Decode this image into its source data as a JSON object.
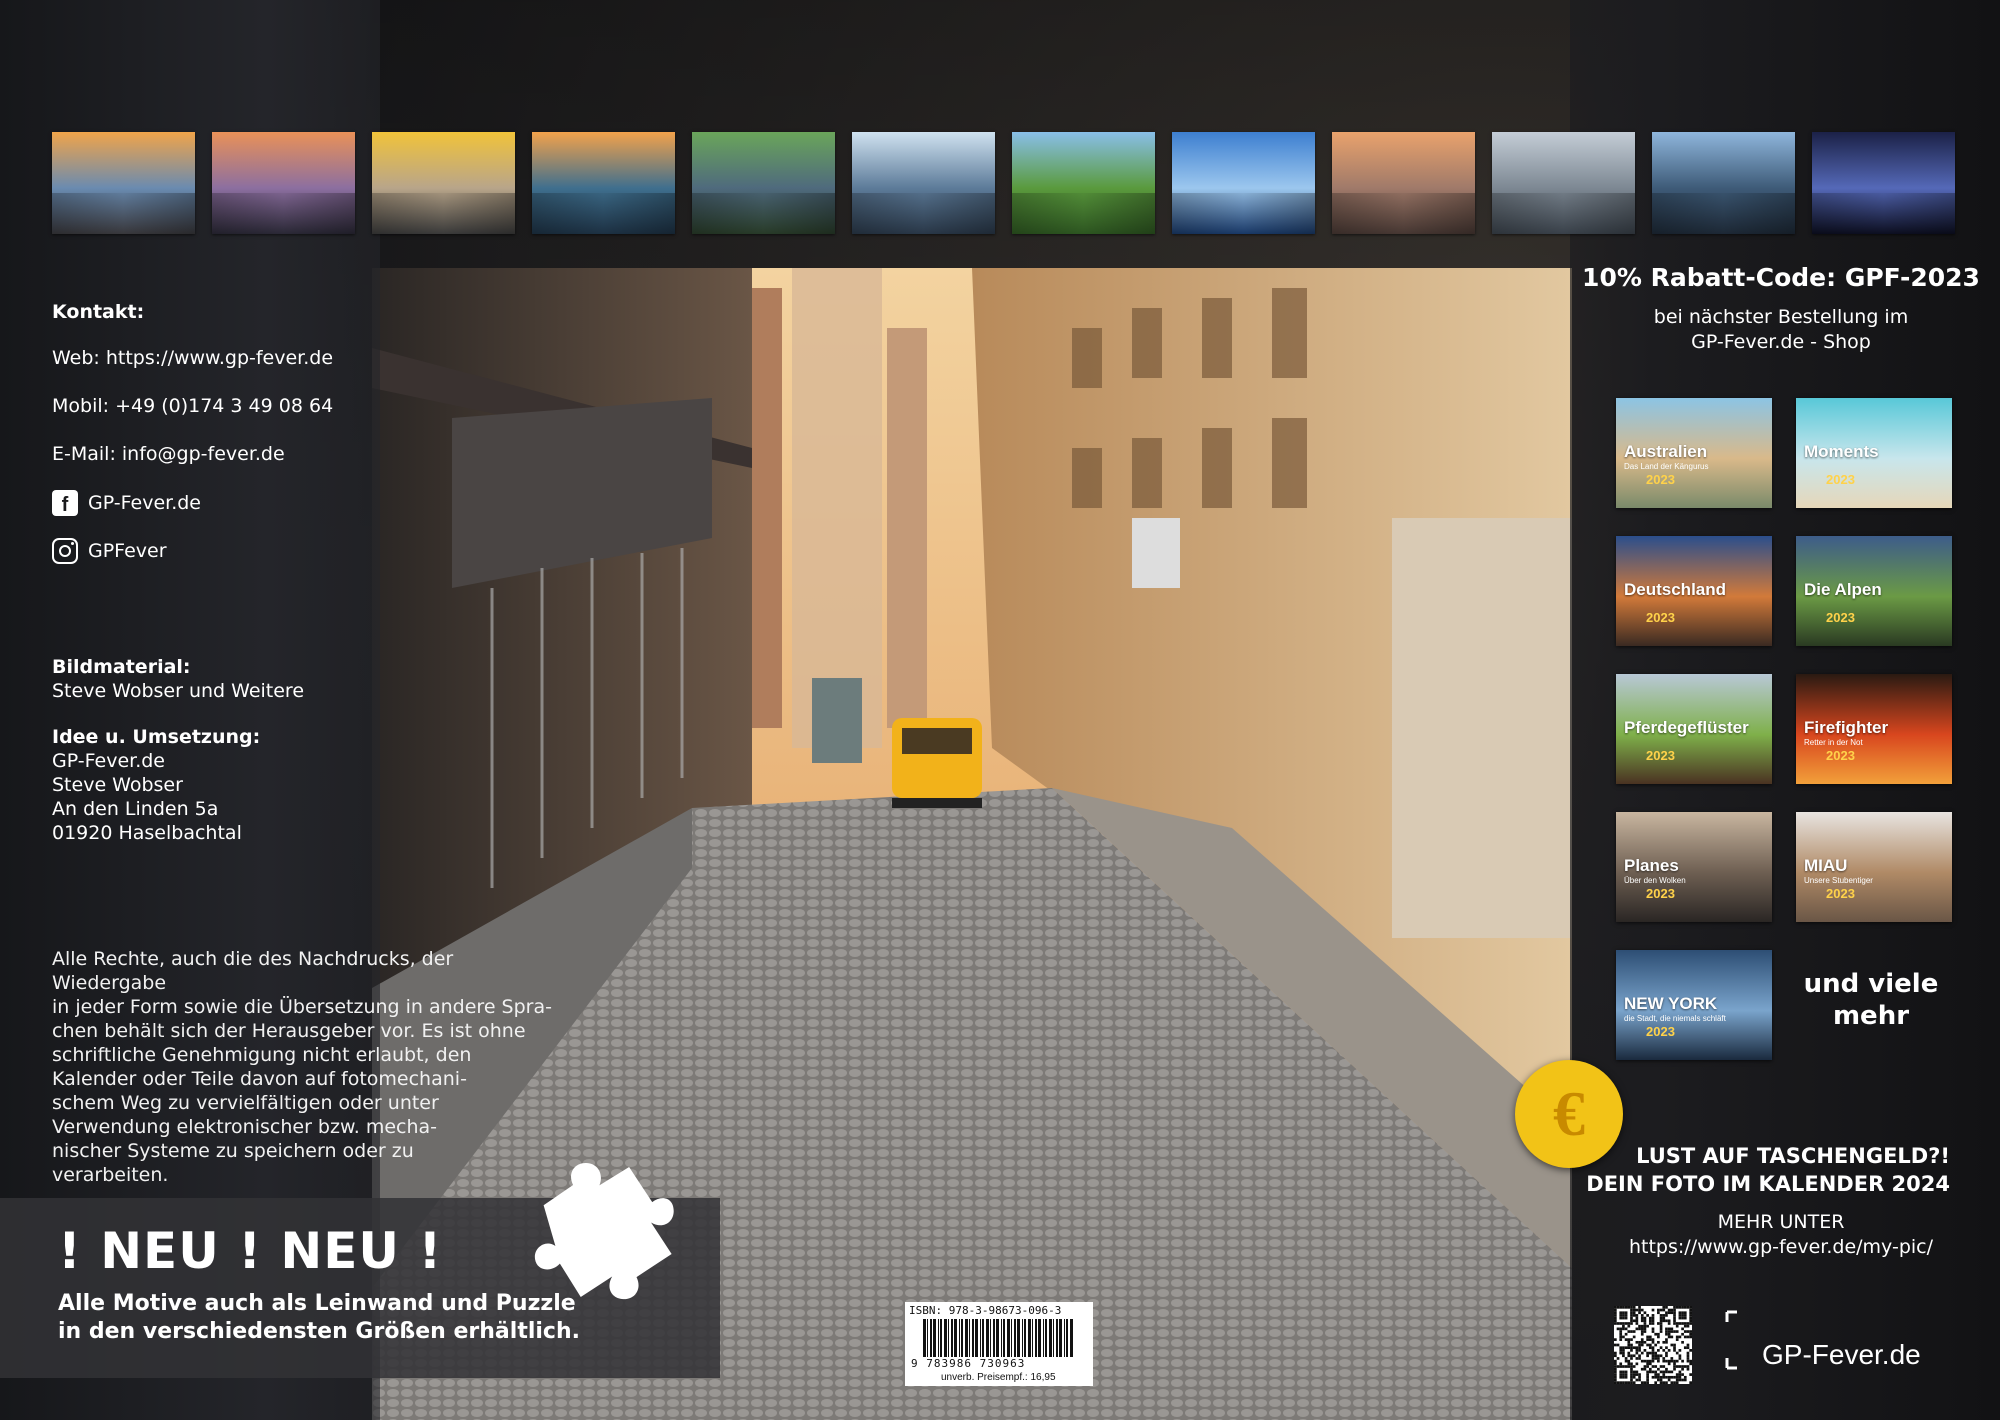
{
  "thumbnails": [
    {
      "name": "brooklyn-bridge-sunset",
      "colors": [
        "#f0a44a",
        "#6a8bb0",
        "#3b3a3e"
      ]
    },
    {
      "name": "statue-of-liberty",
      "colors": [
        "#e99158",
        "#8c6fa0",
        "#2c2a38"
      ]
    },
    {
      "name": "yellow-taxis",
      "colors": [
        "#f1c33a",
        "#b8a58a",
        "#3d3d3d"
      ]
    },
    {
      "name": "manhattan-aerial",
      "colors": [
        "#f2a24b",
        "#3f6f8e",
        "#1e3346"
      ]
    },
    {
      "name": "central-park-aerial",
      "colors": [
        "#6aa55a",
        "#4f6a7d",
        "#2a3e2a"
      ]
    },
    {
      "name": "skyline-waterfront",
      "colors": [
        "#cfe2f0",
        "#5d7b99",
        "#2b3a4b"
      ]
    },
    {
      "name": "park-trees",
      "colors": [
        "#89bfe8",
        "#5a9a3d",
        "#2f5a22"
      ]
    },
    {
      "name": "one-world-trade",
      "colors": [
        "#3d7fd0",
        "#9cc7ee",
        "#1a3b6c"
      ]
    },
    {
      "name": "brooklyn-bridge-walk",
      "colors": [
        "#e9a26c",
        "#a07a6a",
        "#4a3a35"
      ]
    },
    {
      "name": "midtown-skyline",
      "colors": [
        "#c4cdd6",
        "#7d8893",
        "#3c444d"
      ]
    },
    {
      "name": "hudson-yards",
      "colors": [
        "#8fb6dc",
        "#3e5b78",
        "#1e2a38"
      ]
    },
    {
      "name": "tribute-in-light",
      "colors": [
        "#1b2147",
        "#5569b8",
        "#0d0f22"
      ]
    }
  ],
  "contact": {
    "heading": "Kontakt:",
    "web": "Web: https://www.gp-fever.de",
    "mobile": "Mobil: +49 (0)174 3 49 08 64",
    "email": "E-Mail: info@gp-fever.de",
    "facebook": "GP-Fever.de",
    "instagram": "GPFever"
  },
  "credits": {
    "bild_heading": "Bildmaterial:",
    "bild_text": "Steve Wobser und Weitere",
    "idee_heading": "Idee u. Umsetzung:",
    "lines": [
      "GP-Fever.de",
      "Steve Wobser",
      "An den Linden 5a",
      "01920 Haselbachtal"
    ]
  },
  "rights": {
    "lines": [
      "Alle Rechte, auch die des Nachdrucks, der Wiedergabe",
      "in jeder Form sowie die Übersetzung in andere Spra-",
      "chen behält sich der Herausgeber vor. Es ist ohne",
      "schriftliche Genehmigung nicht erlaubt, den",
      "Kalender oder Teile davon auf fotomechani-",
      "schem Weg zu vervielfältigen oder unter",
      "Verwendung elektronischer bzw. mecha-",
      "nischer Systeme zu speichern oder zu",
      "verarbeiten."
    ]
  },
  "neu": {
    "title": "! NEU ! NEU !",
    "line1": "Alle Motive auch als Leinwand und Puzzle",
    "line2": "in den verschiedensten Größen erhältlich."
  },
  "barcode": {
    "isbn": "ISBN: 978-3-98673-096-3",
    "digits": "9 783986 730963",
    "price": "unverb. Preisempf.: 16,95"
  },
  "rabatt": {
    "code": "10% Rabatt-Code: GPF-2023",
    "line1": "bei nächster Bestellung im",
    "line2": "GP-Fever.de - Shop"
  },
  "calendars": [
    {
      "title": "Australien",
      "sub": "Das Land der Kängurus",
      "year": "2023",
      "colors": [
        "#8cc4e4",
        "#d9b98a",
        "#7a8a6a"
      ]
    },
    {
      "title": "Moments",
      "sub": "",
      "year": "2023",
      "colors": [
        "#58c8d8",
        "#c8e6ec",
        "#e6d7b9"
      ]
    },
    {
      "title": "Deutschland",
      "sub": "",
      "year": "2023",
      "colors": [
        "#2b4e8c",
        "#d27a3a",
        "#3a2a22"
      ]
    },
    {
      "title": "Die Alpen",
      "sub": "",
      "year": "2023",
      "colors": [
        "#3d5c8a",
        "#6b9a45",
        "#2a3a22"
      ]
    },
    {
      "title": "Pferdegeflüster",
      "sub": "",
      "year": "2023",
      "colors": [
        "#b8c8d6",
        "#7fb04a",
        "#4a3222"
      ]
    },
    {
      "title": "Firefighter",
      "sub": "Retter in der Not",
      "year": "2023",
      "colors": [
        "#2a1a12",
        "#d8461e",
        "#f2a03a"
      ]
    },
    {
      "title": "Planes",
      "sub": "Über den Wolken",
      "year": "2023",
      "colors": [
        "#c9b6a0",
        "#6e5f52",
        "#2a2624"
      ]
    },
    {
      "title": "MIAU",
      "sub": "Unsere Stubentiger",
      "year": "2023",
      "colors": [
        "#e8e4e0",
        "#b08a66",
        "#6a5646"
      ]
    },
    {
      "title": "NEW YORK",
      "sub": "die Stadt, die niemals schläft",
      "year": "2023",
      "colors": [
        "#2d4e74",
        "#7aa4cc",
        "#1a2a3e"
      ]
    }
  ],
  "more": {
    "line1": "und viele",
    "line2": "mehr"
  },
  "euro_symbol": "€",
  "promo": {
    "line1": "LUST AUF TASCHENGELD?!",
    "line2": "DEIN FOTO IM KALENDER 2024",
    "mehr": "MEHR UNTER",
    "url": "https://www.gp-fever.de/my-pic/"
  },
  "brand": "GP-Fever.de",
  "accent": "#f2c317"
}
